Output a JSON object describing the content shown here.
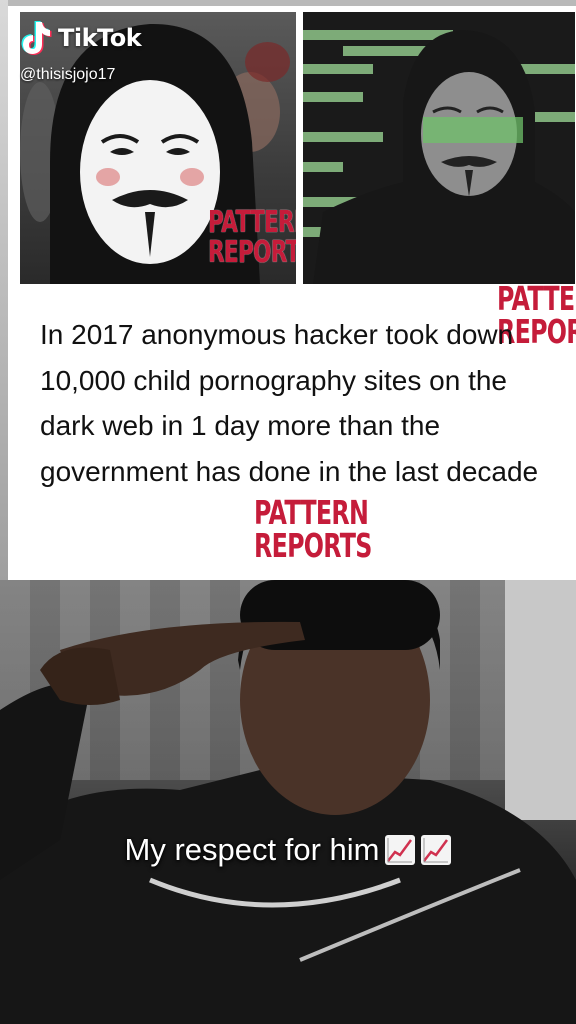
{
  "app": {
    "brand": "TikTok",
    "username": "@thisisjojo17"
  },
  "meme": {
    "watermark_line1": "PATTERN",
    "watermark_line2": "REPORTS",
    "text": "In 2017 anonymous hacker took down 10,000 child pornography sites on the dark web in 1 day more than the government has done in the last decade"
  },
  "video": {
    "caption": "My respect for him"
  },
  "icons": {
    "logo": "tiktok-note-icon",
    "caption_emoji": "chart-increasing-icon"
  },
  "colors": {
    "watermark": "#c51c3a",
    "chart_line": "#d0314f"
  }
}
